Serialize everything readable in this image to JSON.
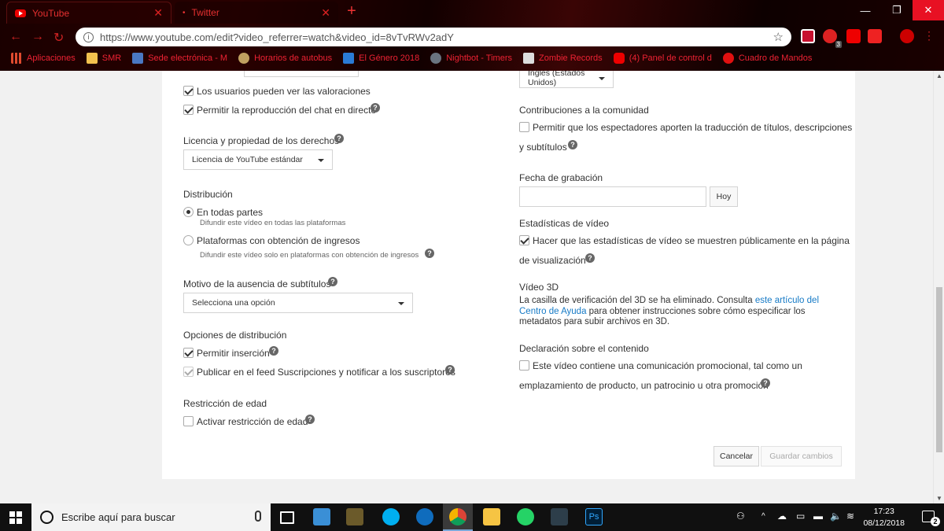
{
  "browser": {
    "tabs": [
      {
        "title": "YouTube"
      },
      {
        "title": "Twitter"
      }
    ],
    "url": "https://www.youtube.com/edit?video_referrer=watch&video_id=8vTvRWv2adY",
    "extension_badge": "3",
    "window_controls": {
      "minimize": "—",
      "maximize": "❐",
      "close": "✕"
    },
    "bookmarks": [
      {
        "label": "Aplicaciones",
        "color": "#e04b2f"
      },
      {
        "label": "SMR",
        "color": "#f2c14e"
      },
      {
        "label": "Sede electrónica - M",
        "color": "#4a78c4"
      },
      {
        "label": "Horarios de autobus",
        "color": "#c0a060"
      },
      {
        "label": "El Género 2018",
        "color": "#2a7bd6"
      },
      {
        "label": "Nightbot - Timers",
        "color": "#6a7480"
      },
      {
        "label": "Zombie Records",
        "color": "#dddddd"
      },
      {
        "label": "(4) Panel de control d",
        "color": "#e00000"
      },
      {
        "label": "Cuadro de Mandos",
        "color": "#e01010"
      }
    ]
  },
  "left": {
    "checks_top": [
      {
        "label": "Los usuarios pueden ver las valoraciones",
        "checked": true
      },
      {
        "label": "Permitir la reproducción del chat en directo",
        "checked": true
      }
    ],
    "license": {
      "heading": "Licencia y propiedad de los derechos",
      "selected": "Licencia de YouTube estándar"
    },
    "distribution": {
      "heading": "Distribución",
      "options": [
        {
          "label": "En todas partes",
          "desc": "Difundir este vídeo en todas las plataformas",
          "selected": true
        },
        {
          "label": "Plataformas con obtención de ingresos",
          "desc": "Difundir este vídeo solo en plataformas con obtención de ingresos",
          "selected": false
        }
      ]
    },
    "subtitles": {
      "heading": "Motivo de la ausencia de subtítulos",
      "selected": "Selecciona una opción"
    },
    "dist_options": {
      "heading": "Opciones de distribución",
      "items": [
        {
          "label": "Permitir inserción",
          "checked": true
        },
        {
          "label": "Publicar en el feed Suscripciones y notificar a los suscriptores",
          "checked": true
        }
      ]
    },
    "age": {
      "heading": "Restricción de edad",
      "label": "Activar restricción de edad"
    }
  },
  "right": {
    "language_selected": "Inglés (Estados Unidos)",
    "community": {
      "heading": "Contribuciones a la comunidad",
      "label_line1": "Permitir que los espectadores aporten la traducción de títulos, descripciones",
      "label_line2": "y subtítulos"
    },
    "recording": {
      "heading": "Fecha de grabación",
      "today": "Hoy"
    },
    "stats": {
      "heading": "Estadísticas de vídeo",
      "label_line1": "Hacer que las estadísticas de vídeo se muestren públicamente en la página",
      "label_line2": "de visualización"
    },
    "video3d": {
      "heading": "Vídeo 3D",
      "text_a": "La casilla de verificación del 3D se ha eliminado. Consulta ",
      "link_a": "este artículo del",
      "link_b": "Centro de Ayuda",
      "text_b": " para obtener instrucciones sobre cómo especificar los",
      "text_c": "metadatos para subir archivos en 3D."
    },
    "content": {
      "heading": "Declaración sobre el contenido",
      "label_line1": "Este vídeo contiene una comunicación promocional, tal como un",
      "label_line2": "emplazamiento de producto, un patrocinio u otra promoción"
    }
  },
  "actions": {
    "cancel": "Cancelar",
    "save": "Guardar cambios"
  },
  "taskbar": {
    "search_placeholder": "Escribe aquí para buscar",
    "time": "17:23",
    "date": "08/12/2018",
    "notifications": "2"
  },
  "colors": {
    "link": "#167ac6",
    "chrome_accent": "#e63030"
  }
}
